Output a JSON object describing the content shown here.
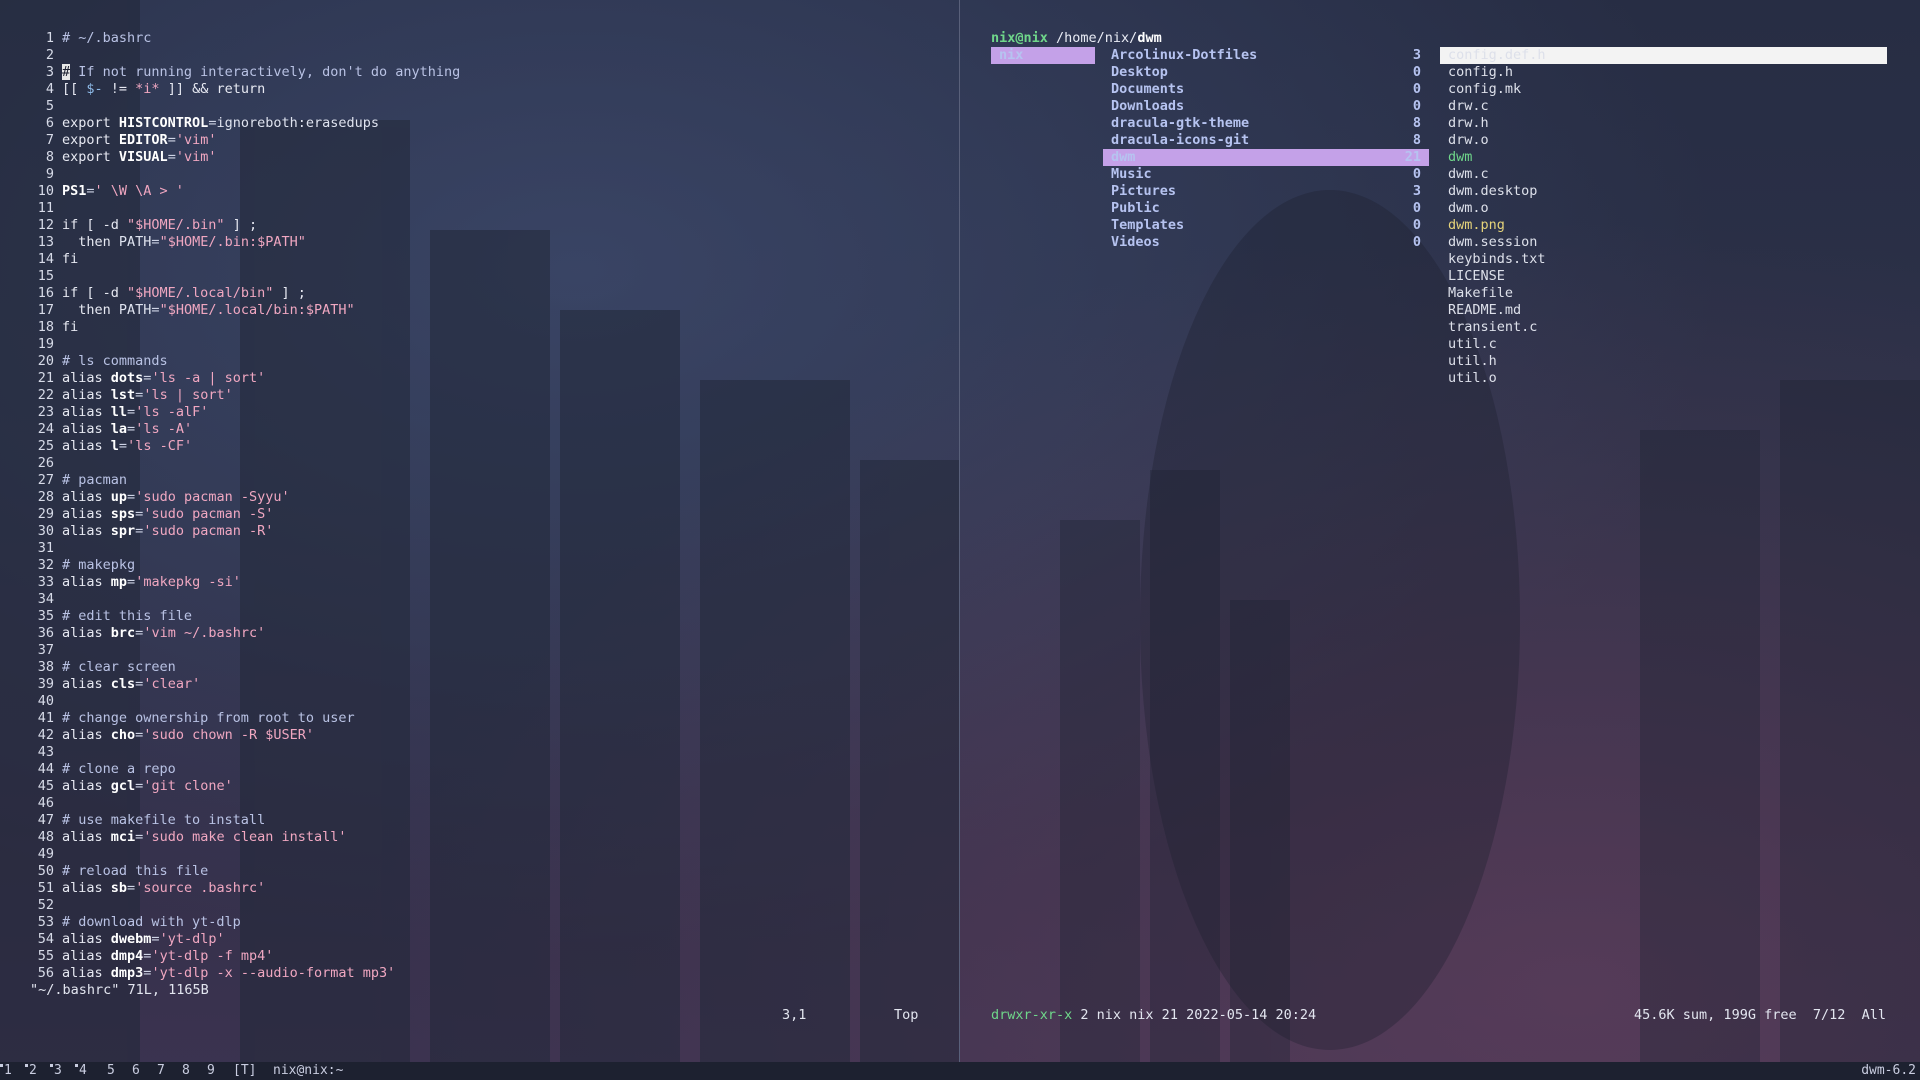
{
  "vim": {
    "lines": [
      {
        "n": "1",
        "parts": [
          [
            "cm",
            "# ~/.bashrc"
          ]
        ]
      },
      {
        "n": "2",
        "parts": []
      },
      {
        "n": "3",
        "parts": [
          [
            "cur",
            "#"
          ],
          [
            "cm",
            " If not running interactively, don't do anything"
          ]
        ]
      },
      {
        "n": "4",
        "parts": [
          [
            "kw",
            "[[ "
          ],
          [
            "dv",
            "$-"
          ],
          [
            "kw",
            " != "
          ],
          [
            "str",
            "*i*"
          ],
          [
            "kw",
            " ]] && return"
          ]
        ]
      },
      {
        "n": "5",
        "parts": []
      },
      {
        "n": "6",
        "parts": [
          [
            "kw",
            "export "
          ],
          [
            "var",
            "HISTCONTROL"
          ],
          [
            "op",
            "="
          ],
          [
            "val",
            "ignoreboth:erasedups"
          ]
        ]
      },
      {
        "n": "7",
        "parts": [
          [
            "kw",
            "export "
          ],
          [
            "var",
            "EDITOR"
          ],
          [
            "op",
            "="
          ],
          [
            "str",
            "'vim'"
          ]
        ]
      },
      {
        "n": "8",
        "parts": [
          [
            "kw",
            "export "
          ],
          [
            "var",
            "VISUAL"
          ],
          [
            "op",
            "="
          ],
          [
            "str",
            "'vim'"
          ]
        ]
      },
      {
        "n": "9",
        "parts": []
      },
      {
        "n": "10",
        "parts": [
          [
            "var",
            "PS1"
          ],
          [
            "op",
            "="
          ],
          [
            "str",
            "' \\W \\A > '"
          ]
        ]
      },
      {
        "n": "11",
        "parts": []
      },
      {
        "n": "12",
        "parts": [
          [
            "kw",
            "if [ -d "
          ],
          [
            "str",
            "\"$HOME/.bin\""
          ],
          [
            "kw",
            " ] ;"
          ]
        ]
      },
      {
        "n": "13",
        "parts": [
          [
            "kw",
            "  then "
          ],
          [
            "val",
            "PATH"
          ],
          [
            "op",
            "="
          ],
          [
            "str",
            "\"$HOME/.bin:$PATH\""
          ]
        ]
      },
      {
        "n": "14",
        "parts": [
          [
            "kw",
            "fi"
          ]
        ]
      },
      {
        "n": "15",
        "parts": []
      },
      {
        "n": "16",
        "parts": [
          [
            "kw",
            "if [ -d "
          ],
          [
            "str",
            "\"$HOME/.local/bin\""
          ],
          [
            "kw",
            " ] ;"
          ]
        ]
      },
      {
        "n": "17",
        "parts": [
          [
            "kw",
            "  then "
          ],
          [
            "val",
            "PATH"
          ],
          [
            "op",
            "="
          ],
          [
            "str",
            "\"$HOME/.local/bin:$PATH\""
          ]
        ]
      },
      {
        "n": "18",
        "parts": [
          [
            "kw",
            "fi"
          ]
        ]
      },
      {
        "n": "19",
        "parts": []
      },
      {
        "n": "20",
        "parts": [
          [
            "cm",
            "# ls commands"
          ]
        ]
      },
      {
        "n": "21",
        "parts": [
          [
            "kw",
            "alias "
          ],
          [
            "var",
            "dots"
          ],
          [
            "op",
            "="
          ],
          [
            "str",
            "'ls -a | sort'"
          ]
        ]
      },
      {
        "n": "22",
        "parts": [
          [
            "kw",
            "alias "
          ],
          [
            "var",
            "lst"
          ],
          [
            "op",
            "="
          ],
          [
            "str",
            "'ls | sort'"
          ]
        ]
      },
      {
        "n": "23",
        "parts": [
          [
            "kw",
            "alias "
          ],
          [
            "var",
            "ll"
          ],
          [
            "op",
            "="
          ],
          [
            "str",
            "'ls -alF'"
          ]
        ]
      },
      {
        "n": "24",
        "parts": [
          [
            "kw",
            "alias "
          ],
          [
            "var",
            "la"
          ],
          [
            "op",
            "="
          ],
          [
            "str",
            "'ls -A'"
          ]
        ]
      },
      {
        "n": "25",
        "parts": [
          [
            "kw",
            "alias "
          ],
          [
            "var",
            "l"
          ],
          [
            "op",
            "="
          ],
          [
            "str",
            "'ls -CF'"
          ]
        ]
      },
      {
        "n": "26",
        "parts": []
      },
      {
        "n": "27",
        "parts": [
          [
            "cm",
            "# pacman"
          ]
        ]
      },
      {
        "n": "28",
        "parts": [
          [
            "kw",
            "alias "
          ],
          [
            "var",
            "up"
          ],
          [
            "op",
            "="
          ],
          [
            "str",
            "'sudo pacman -Syyu'"
          ]
        ]
      },
      {
        "n": "29",
        "parts": [
          [
            "kw",
            "alias "
          ],
          [
            "var",
            "sps"
          ],
          [
            "op",
            "="
          ],
          [
            "str",
            "'sudo pacman -S'"
          ]
        ]
      },
      {
        "n": "30",
        "parts": [
          [
            "kw",
            "alias "
          ],
          [
            "var",
            "spr"
          ],
          [
            "op",
            "="
          ],
          [
            "str",
            "'sudo pacman -R'"
          ]
        ]
      },
      {
        "n": "31",
        "parts": []
      },
      {
        "n": "32",
        "parts": [
          [
            "cm",
            "# makepkg"
          ]
        ]
      },
      {
        "n": "33",
        "parts": [
          [
            "kw",
            "alias "
          ],
          [
            "var",
            "mp"
          ],
          [
            "op",
            "="
          ],
          [
            "str",
            "'makepkg -si'"
          ]
        ]
      },
      {
        "n": "34",
        "parts": []
      },
      {
        "n": "35",
        "parts": [
          [
            "cm",
            "# edit this file"
          ]
        ]
      },
      {
        "n": "36",
        "parts": [
          [
            "kw",
            "alias "
          ],
          [
            "var",
            "brc"
          ],
          [
            "op",
            "="
          ],
          [
            "str",
            "'vim ~/.bashrc'"
          ]
        ]
      },
      {
        "n": "37",
        "parts": []
      },
      {
        "n": "38",
        "parts": [
          [
            "cm",
            "# clear screen"
          ]
        ]
      },
      {
        "n": "39",
        "parts": [
          [
            "kw",
            "alias "
          ],
          [
            "var",
            "cls"
          ],
          [
            "op",
            "="
          ],
          [
            "str",
            "'clear'"
          ]
        ]
      },
      {
        "n": "40",
        "parts": []
      },
      {
        "n": "41",
        "parts": [
          [
            "cm",
            "# change ownership from root to user"
          ]
        ]
      },
      {
        "n": "42",
        "parts": [
          [
            "kw",
            "alias "
          ],
          [
            "var",
            "cho"
          ],
          [
            "op",
            "="
          ],
          [
            "str",
            "'sudo chown -R $USER'"
          ]
        ]
      },
      {
        "n": "43",
        "parts": []
      },
      {
        "n": "44",
        "parts": [
          [
            "cm",
            "# clone a repo"
          ]
        ]
      },
      {
        "n": "45",
        "parts": [
          [
            "kw",
            "alias "
          ],
          [
            "var",
            "gcl"
          ],
          [
            "op",
            "="
          ],
          [
            "str",
            "'git clone'"
          ]
        ]
      },
      {
        "n": "46",
        "parts": []
      },
      {
        "n": "47",
        "parts": [
          [
            "cm",
            "# use makefile to install"
          ]
        ]
      },
      {
        "n": "48",
        "parts": [
          [
            "kw",
            "alias "
          ],
          [
            "var",
            "mci"
          ],
          [
            "op",
            "="
          ],
          [
            "str",
            "'sudo make clean install'"
          ]
        ]
      },
      {
        "n": "49",
        "parts": []
      },
      {
        "n": "50",
        "parts": [
          [
            "cm",
            "# reload this file"
          ]
        ]
      },
      {
        "n": "51",
        "parts": [
          [
            "kw",
            "alias "
          ],
          [
            "var",
            "sb"
          ],
          [
            "op",
            "="
          ],
          [
            "str",
            "'source .bashrc'"
          ]
        ]
      },
      {
        "n": "52",
        "parts": []
      },
      {
        "n": "53",
        "parts": [
          [
            "cm",
            "# download with yt-dlp"
          ]
        ]
      },
      {
        "n": "54",
        "parts": [
          [
            "kw",
            "alias "
          ],
          [
            "var",
            "dwebm"
          ],
          [
            "op",
            "="
          ],
          [
            "str",
            "'yt-dlp'"
          ]
        ]
      },
      {
        "n": "55",
        "parts": [
          [
            "kw",
            "alias "
          ],
          [
            "var",
            "dmp4"
          ],
          [
            "op",
            "="
          ],
          [
            "str",
            "'yt-dlp -f mp4'"
          ]
        ]
      },
      {
        "n": "56",
        "parts": [
          [
            "kw",
            "alias "
          ],
          [
            "var",
            "dmp3"
          ],
          [
            "op",
            "="
          ],
          [
            "str",
            "'yt-dlp -x --audio-format mp3'"
          ]
        ]
      }
    ],
    "message": "\"~/.bashrc\" 71L, 1165B",
    "ruler": "3,1",
    "position": "Top"
  },
  "lf": {
    "header": {
      "user": "nix@nix",
      "path": " /home/nix/",
      "current": "dwm"
    },
    "parent": [
      {
        "name": "nix",
        "selected": true
      }
    ],
    "dirs": [
      {
        "name": "Arcolinux-Dotfiles",
        "count": "3"
      },
      {
        "name": "Desktop",
        "count": "0"
      },
      {
        "name": "Documents",
        "count": "0"
      },
      {
        "name": "Downloads",
        "count": "0"
      },
      {
        "name": "dracula-gtk-theme",
        "count": "8"
      },
      {
        "name": "dracula-icons-git",
        "count": "8"
      },
      {
        "name": "dwm",
        "count": "21",
        "selected": true
      },
      {
        "name": "Music",
        "count": "0"
      },
      {
        "name": "Pictures",
        "count": "3"
      },
      {
        "name": "Public",
        "count": "0"
      },
      {
        "name": "Templates",
        "count": "0"
      },
      {
        "name": "Videos",
        "count": "0"
      }
    ],
    "files": [
      {
        "name": "config.def.h",
        "kind": "file",
        "selected": true
      },
      {
        "name": "config.h",
        "kind": "file"
      },
      {
        "name": "config.mk",
        "kind": "file"
      },
      {
        "name": "drw.c",
        "kind": "file"
      },
      {
        "name": "drw.h",
        "kind": "file"
      },
      {
        "name": "drw.o",
        "kind": "file"
      },
      {
        "name": "dwm",
        "kind": "exec"
      },
      {
        "name": "dwm.c",
        "kind": "file"
      },
      {
        "name": "dwm.desktop",
        "kind": "file"
      },
      {
        "name": "dwm.o",
        "kind": "file"
      },
      {
        "name": "dwm.png",
        "kind": "image"
      },
      {
        "name": "dwm.session",
        "kind": "file"
      },
      {
        "name": "keybinds.txt",
        "kind": "file"
      },
      {
        "name": "LICENSE",
        "kind": "file"
      },
      {
        "name": "Makefile",
        "kind": "file"
      },
      {
        "name": "README.md",
        "kind": "file"
      },
      {
        "name": "transient.c",
        "kind": "file"
      },
      {
        "name": "util.c",
        "kind": "file"
      },
      {
        "name": "util.h",
        "kind": "file"
      },
      {
        "name": "util.o",
        "kind": "file"
      }
    ],
    "status": {
      "perms": "drwxr-xr-x",
      "info": " 2 nix nix 21 2022-05-14 20:24",
      "right": "45.6K sum, 199G free  7/12  All"
    }
  },
  "bar": {
    "tags": [
      "1",
      "2",
      "3",
      "4",
      "5",
      "6",
      "7",
      "8",
      "9"
    ],
    "layout": "[T]",
    "title": "nix@nix:~",
    "status": "dwm-6.2"
  },
  "colors": {
    "selection": "#c4a1e8",
    "accent_green": "#6fd68a",
    "bar_bg": "#1d2130"
  }
}
